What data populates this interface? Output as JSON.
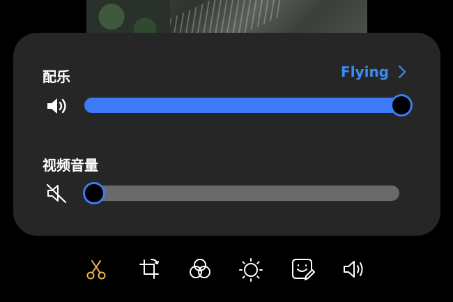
{
  "music": {
    "label": "配乐",
    "track_name": "Flying",
    "volume": 1.0
  },
  "video_volume": {
    "label": "视频音量",
    "volume": 0.0,
    "muted": true
  },
  "toolbar": {
    "tools": [
      "trim-icon",
      "crop-rotate-icon",
      "filter-icon",
      "brightness-icon",
      "sticker-icon",
      "audio-icon"
    ],
    "active_tool": "trim-icon",
    "active_color": "#f2b84b"
  },
  "colors": {
    "accent": "#3b7cf6",
    "link": "#3b8bf5",
    "panel": "#262626"
  }
}
